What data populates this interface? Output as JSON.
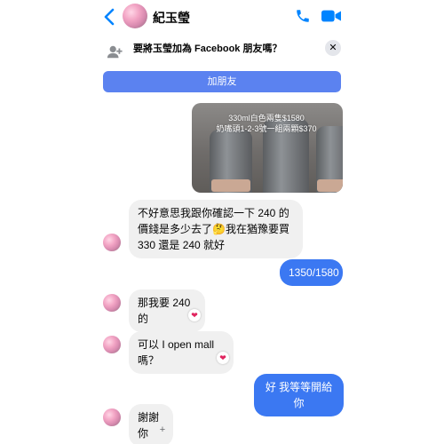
{
  "header": {
    "contact_name": "紀玉瑩",
    "icons": [
      "back-chevron-icon",
      "phone-icon",
      "video-camera-icon"
    ]
  },
  "banner": {
    "prompt": "要將玉瑩加為 Facebook 朋友嗎？",
    "close_label": "✕",
    "add_friend_label": "加朋友"
  },
  "photo": {
    "caption_line1": "330ml白色兩隻$1580",
    "caption_line2": "奶嘴頭1-2-3號一組兩顆$370"
  },
  "messages": [
    {
      "from": "them",
      "text": "不好意思我跟你確認一下 240 的價錢是多少去了🤔我在猶豫要買 330 還是 240 就好"
    },
    {
      "from": "me",
      "text": "1350/1580"
    },
    {
      "from": "them",
      "text": "那我要 240 的",
      "reaction": "❤"
    },
    {
      "from": "them",
      "text": "可以 I open mall 嗎？",
      "reaction": "❤"
    },
    {
      "from": "me",
      "text": "好 我等等開給你"
    },
    {
      "from": "them",
      "text": "謝謝你",
      "reaction": "+"
    }
  ],
  "colors": {
    "accent": "#0084ff",
    "add_button": "#5b82f0",
    "outgoing_bubble": "#3b78f2",
    "incoming_bubble": "#f0f0f0",
    "reaction_heart": "#e0245e"
  }
}
